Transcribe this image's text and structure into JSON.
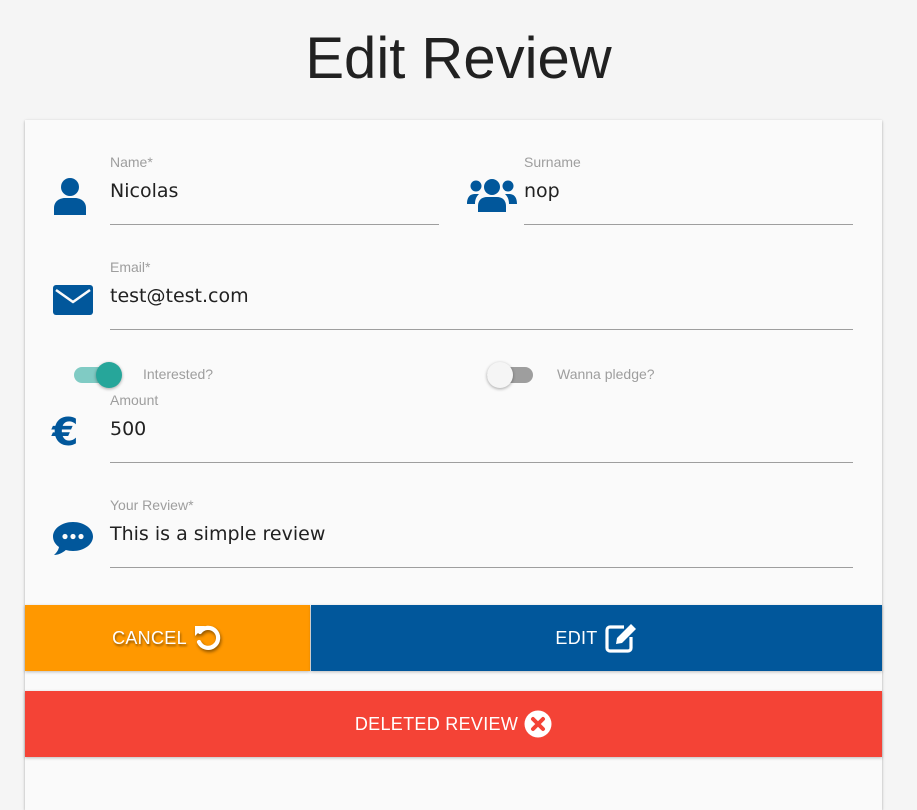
{
  "page": {
    "title": "Edit Review"
  },
  "form": {
    "name": {
      "label": "Name*",
      "value": "Nicolas"
    },
    "surname": {
      "label": "Surname",
      "value": "nop"
    },
    "email": {
      "label": "Email*",
      "value": "test@test.com"
    },
    "interested": {
      "label": "Interested?",
      "checked": true
    },
    "pledge": {
      "label": "Wanna pledge?",
      "checked": false
    },
    "amount": {
      "label": "Amount",
      "value": "500"
    },
    "review": {
      "label": "Your Review*",
      "value": "This is a simple review"
    }
  },
  "buttons": {
    "cancel_label": "CANCEL",
    "edit_label": "EDIT",
    "delete_label": "DELETED REVIEW"
  },
  "colors": {
    "icon": "#01579b",
    "cancel": "#ff9800",
    "edit": "#01579b",
    "delete": "#f44336",
    "toggle_on": "#26a69a"
  }
}
